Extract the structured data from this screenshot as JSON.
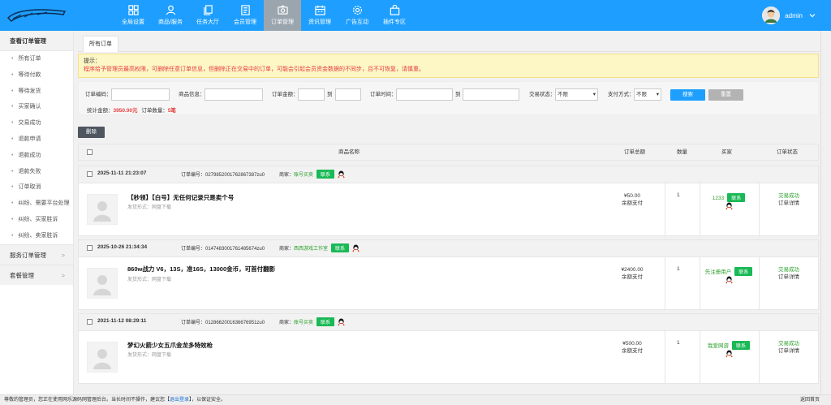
{
  "header": {
    "nav": [
      {
        "label": "全局设置",
        "icon": "grid-icon"
      },
      {
        "label": "商品/服务",
        "icon": "person-icon"
      },
      {
        "label": "任务大厅",
        "icon": "copy-icon"
      },
      {
        "label": "会员管理",
        "icon": "document-icon"
      },
      {
        "label": "订单管理",
        "icon": "camera-icon"
      },
      {
        "label": "资讯管理",
        "icon": "calendar-icon"
      },
      {
        "label": "广告互动",
        "icon": "gear-icon"
      },
      {
        "label": "插件专区",
        "icon": "bag-icon"
      }
    ],
    "active_nav": "订单管理",
    "user": "admin"
  },
  "sidebar": {
    "title": "查看订单管理",
    "items": [
      "所有订单",
      "等待付款",
      "等待发货",
      "买家确认",
      "交易成功",
      "退款申请",
      "退款成功",
      "退款失败",
      "订单取消",
      "纠纷、需要平台处理",
      "纠纷、买家胜诉",
      "纠纷、卖家胜诉"
    ],
    "groups": [
      {
        "label": "服务订单管理",
        "chevron": ">"
      },
      {
        "label": "套餐管理",
        "chevron": ">"
      }
    ]
  },
  "tabs": [
    "所有订单"
  ],
  "notice": {
    "title": "提示：",
    "content": "程序给予管理员最高权限，可删除任意订单信息，但删除正在交易中的订单，可能会引起会员资金数据的不同步，且不可恢复，请慎重。"
  },
  "filter": {
    "order_no": "订单编码：",
    "product": "商品信息：",
    "amount": "订单金额：",
    "to1": "到",
    "time": "订单时间：",
    "to2": "到",
    "trade_status": "交易状态：",
    "trade_value": "不限",
    "pay_method": "支付方式：",
    "pay_value": "不限",
    "search": "搜索",
    "reset": "重置",
    "stats_prefix": "统计金额：",
    "stats_amount": "3950.00元",
    "stats_count_label": "订单数量：",
    "stats_count": "5笔"
  },
  "delete_btn": "删除",
  "table_headers": {
    "name": "商品名称",
    "total": "订单总额",
    "qty": "数量",
    "buyer": "买家",
    "status": "订单状态"
  },
  "orders": [
    {
      "time": "2025-11-11 21:23:07",
      "order_no": "订单编号：02798520017628673​87zu0",
      "merchant_label": "商家：",
      "merchant": "账号买卖",
      "contact": "联系",
      "product": "【秒领】【白号】无任何记录只是卖个号",
      "mode": "发货形式：网盘下载",
      "price": "¥50.00",
      "pay": "余额支付",
      "qty": "1",
      "buyer": "1233",
      "status": "交易成功",
      "detail": "订单详情"
    },
    {
      "time": "2025-10-26 21:34:34",
      "order_no": "订单编号：01474830017614856​74zu0",
      "merchant_label": "商家：",
      "merchant": "西西游戏工作室",
      "contact": "联系",
      "product": "860w战力 V6，13S，准16S，13000金币，可首付翻影",
      "mode": "发货形式：网盘下载",
      "price": "¥2400.00",
      "pay": "余额支付",
      "qty": "1",
      "buyer": "先注册用户",
      "status": "交易成功",
      "detail": "订单详情"
    },
    {
      "time": "2021-11-12 08:29:11",
      "order_no": "订单编号：01286620016366​76951zu0",
      "merchant_label": "商家：",
      "merchant": "账号买卖",
      "contact": "联系",
      "product": "梦幻火箭少女五爪金龙多特效枪",
      "mode": "发货形式：网盘下载",
      "price": "¥500.00",
      "pay": "余额支付",
      "qty": "1",
      "buyer": "我爱网游",
      "status": "交易成功",
      "detail": "订单详情"
    }
  ],
  "footer": {
    "text1": "尊敬的管理员，您正在使用网乐源码网管理后台。当长时间不操作，建议您【",
    "logout": "退出登录",
    "text2": "】，以保证安全。",
    "right": "返回首页"
  }
}
